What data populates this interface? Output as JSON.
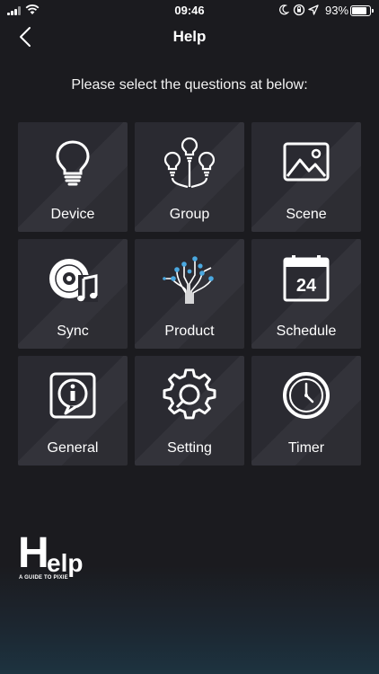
{
  "status_bar": {
    "time": "09:46",
    "battery": "93%",
    "battery_level": 0.93
  },
  "nav": {
    "title": "Help",
    "back_icon": "chevron-left-icon"
  },
  "subtitle": "Please select the questions at below:",
  "tiles": [
    {
      "label": "Device",
      "icon": "bulb-icon"
    },
    {
      "label": "Group",
      "icon": "bulb-group-icon"
    },
    {
      "label": "Scene",
      "icon": "picture-icon"
    },
    {
      "label": "Sync",
      "icon": "music-disc-icon"
    },
    {
      "label": "Product",
      "icon": "network-icon"
    },
    {
      "label": "Schedule",
      "icon": "calendar-icon"
    },
    {
      "label": "General",
      "icon": "info-icon"
    },
    {
      "label": "Setting",
      "icon": "gear-icon"
    },
    {
      "label": "Timer",
      "icon": "clock-icon"
    }
  ],
  "calendar_day": "24",
  "logo": {
    "letter_h": "H",
    "rest": "elp",
    "tagline": "A GUIDE TO PIXIE"
  },
  "colors": {
    "background": "#1b1b1f",
    "tile": "#2a2a31",
    "text": "#ffffff",
    "accent_blue": "#4aa8e0"
  }
}
